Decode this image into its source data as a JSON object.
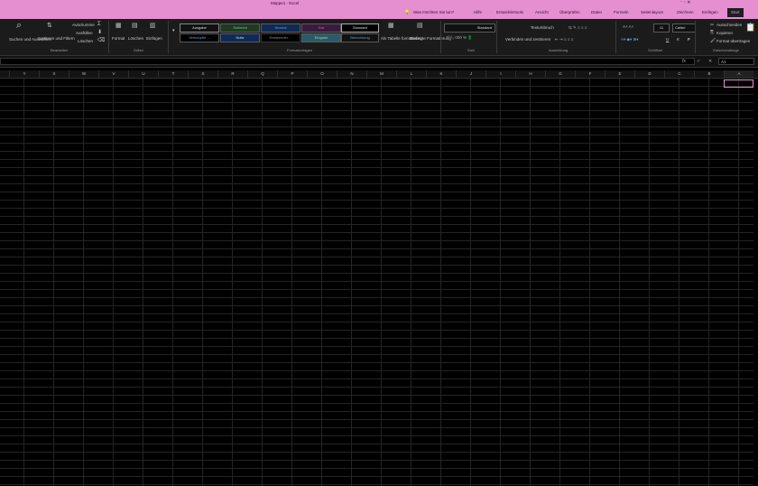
{
  "window": {
    "title": "Mappe1 - Excel",
    "controls": "⁻ ▫ ✕"
  },
  "menu": {
    "tabs": [
      "Start",
      "Einfügen",
      "Zeichnen",
      "Seitenlayout",
      "Formeln",
      "Daten",
      "Überprüfen",
      "Ansicht",
      "Entwicklertools",
      "Hilfe"
    ],
    "search": "Was möchten Sie tun?"
  },
  "ribbon": {
    "clipboard": {
      "cut": "Ausschneiden",
      "copy": "Kopieren",
      "format_painter": "Format übertragen",
      "label": "Zwischenablage"
    },
    "font": {
      "name": "Calibri",
      "size": "11",
      "label": "Schriftart",
      "bold": "F",
      "italic": "K",
      "underline": "U"
    },
    "alignment": {
      "wrap": "Textumbruch",
      "merge": "Verbinden und zentrieren",
      "label": "Ausrichtung"
    },
    "number": {
      "format": "Standard",
      "label": "Zahl"
    },
    "styles": {
      "conditional": "Bedingte Formatierung",
      "as_table": "Als Tabelle formatieren",
      "cells": [
        "Standard",
        "Gut",
        "Neutral",
        "Schlecht",
        "Ausgabe",
        "Berechnung",
        "Eingabe",
        "Erklärender ...",
        "Notiz",
        "Verknüpfte ..."
      ],
      "label": "Formatvorlagen"
    },
    "cells": {
      "insert": "Einfügen",
      "delete": "Löschen",
      "format": "Format",
      "label": "Zellen"
    },
    "editing": {
      "autosum": "AutoSumme",
      "fill": "Ausfüllen",
      "clear": "Löschen",
      "sort": "Sortieren und Filtern",
      "find": "Suchen und Auswählen",
      "label": "Bearbeiten"
    }
  },
  "formula_bar": {
    "name_box": "A1",
    "fx": "fx"
  },
  "sheet": {
    "columns": [
      "Y",
      "X",
      "W",
      "V",
      "U",
      "T",
      "S",
      "R",
      "Q",
      "P",
      "O",
      "N",
      "M",
      "L",
      "K",
      "J",
      "I",
      "H",
      "G",
      "F",
      "E",
      "D",
      "C",
      "B",
      "A"
    ],
    "selected_column": "A"
  },
  "colors": {
    "accent": "#e58fd0",
    "ribbon_bg": "#1b1b1b",
    "sheet_bg": "#000000",
    "gridline": "#242424"
  }
}
